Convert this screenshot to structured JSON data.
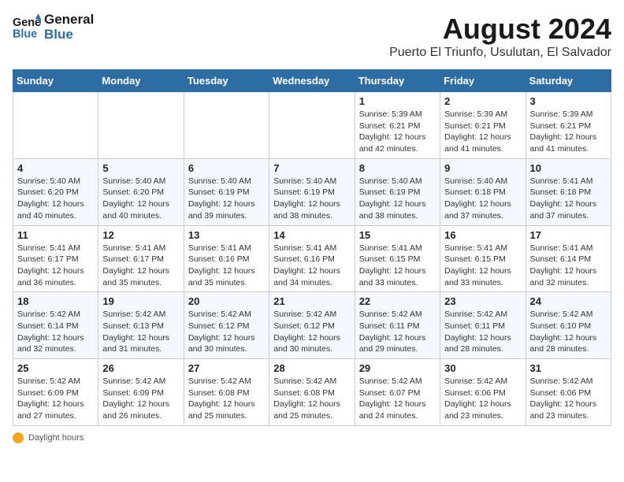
{
  "logo": {
    "line1": "General",
    "line2": "Blue"
  },
  "header": {
    "month": "August 2024",
    "location": "Puerto El Triunfo, Usulutan, El Salvador"
  },
  "days_of_week": [
    "Sunday",
    "Monday",
    "Tuesday",
    "Wednesday",
    "Thursday",
    "Friday",
    "Saturday"
  ],
  "weeks": [
    [
      {
        "day": "",
        "info": ""
      },
      {
        "day": "",
        "info": ""
      },
      {
        "day": "",
        "info": ""
      },
      {
        "day": "",
        "info": ""
      },
      {
        "day": "1",
        "info": "Sunrise: 5:39 AM\nSunset: 6:21 PM\nDaylight: 12 hours\nand 42 minutes."
      },
      {
        "day": "2",
        "info": "Sunrise: 5:39 AM\nSunset: 6:21 PM\nDaylight: 12 hours\nand 41 minutes."
      },
      {
        "day": "3",
        "info": "Sunrise: 5:39 AM\nSunset: 6:21 PM\nDaylight: 12 hours\nand 41 minutes."
      }
    ],
    [
      {
        "day": "4",
        "info": "Sunrise: 5:40 AM\nSunset: 6:20 PM\nDaylight: 12 hours\nand 40 minutes."
      },
      {
        "day": "5",
        "info": "Sunrise: 5:40 AM\nSunset: 6:20 PM\nDaylight: 12 hours\nand 40 minutes."
      },
      {
        "day": "6",
        "info": "Sunrise: 5:40 AM\nSunset: 6:19 PM\nDaylight: 12 hours\nand 39 minutes."
      },
      {
        "day": "7",
        "info": "Sunrise: 5:40 AM\nSunset: 6:19 PM\nDaylight: 12 hours\nand 38 minutes."
      },
      {
        "day": "8",
        "info": "Sunrise: 5:40 AM\nSunset: 6:19 PM\nDaylight: 12 hours\nand 38 minutes."
      },
      {
        "day": "9",
        "info": "Sunrise: 5:40 AM\nSunset: 6:18 PM\nDaylight: 12 hours\nand 37 minutes."
      },
      {
        "day": "10",
        "info": "Sunrise: 5:41 AM\nSunset: 6:18 PM\nDaylight: 12 hours\nand 37 minutes."
      }
    ],
    [
      {
        "day": "11",
        "info": "Sunrise: 5:41 AM\nSunset: 6:17 PM\nDaylight: 12 hours\nand 36 minutes."
      },
      {
        "day": "12",
        "info": "Sunrise: 5:41 AM\nSunset: 6:17 PM\nDaylight: 12 hours\nand 35 minutes."
      },
      {
        "day": "13",
        "info": "Sunrise: 5:41 AM\nSunset: 6:16 PM\nDaylight: 12 hours\nand 35 minutes."
      },
      {
        "day": "14",
        "info": "Sunrise: 5:41 AM\nSunset: 6:16 PM\nDaylight: 12 hours\nand 34 minutes."
      },
      {
        "day": "15",
        "info": "Sunrise: 5:41 AM\nSunset: 6:15 PM\nDaylight: 12 hours\nand 33 minutes."
      },
      {
        "day": "16",
        "info": "Sunrise: 5:41 AM\nSunset: 6:15 PM\nDaylight: 12 hours\nand 33 minutes."
      },
      {
        "day": "17",
        "info": "Sunrise: 5:41 AM\nSunset: 6:14 PM\nDaylight: 12 hours\nand 32 minutes."
      }
    ],
    [
      {
        "day": "18",
        "info": "Sunrise: 5:42 AM\nSunset: 6:14 PM\nDaylight: 12 hours\nand 32 minutes."
      },
      {
        "day": "19",
        "info": "Sunrise: 5:42 AM\nSunset: 6:13 PM\nDaylight: 12 hours\nand 31 minutes."
      },
      {
        "day": "20",
        "info": "Sunrise: 5:42 AM\nSunset: 6:12 PM\nDaylight: 12 hours\nand 30 minutes."
      },
      {
        "day": "21",
        "info": "Sunrise: 5:42 AM\nSunset: 6:12 PM\nDaylight: 12 hours\nand 30 minutes."
      },
      {
        "day": "22",
        "info": "Sunrise: 5:42 AM\nSunset: 6:11 PM\nDaylight: 12 hours\nand 29 minutes."
      },
      {
        "day": "23",
        "info": "Sunrise: 5:42 AM\nSunset: 6:11 PM\nDaylight: 12 hours\nand 28 minutes."
      },
      {
        "day": "24",
        "info": "Sunrise: 5:42 AM\nSunset: 6:10 PM\nDaylight: 12 hours\nand 28 minutes."
      }
    ],
    [
      {
        "day": "25",
        "info": "Sunrise: 5:42 AM\nSunset: 6:09 PM\nDaylight: 12 hours\nand 27 minutes."
      },
      {
        "day": "26",
        "info": "Sunrise: 5:42 AM\nSunset: 6:09 PM\nDaylight: 12 hours\nand 26 minutes."
      },
      {
        "day": "27",
        "info": "Sunrise: 5:42 AM\nSunset: 6:08 PM\nDaylight: 12 hours\nand 25 minutes."
      },
      {
        "day": "28",
        "info": "Sunrise: 5:42 AM\nSunset: 6:08 PM\nDaylight: 12 hours\nand 25 minutes."
      },
      {
        "day": "29",
        "info": "Sunrise: 5:42 AM\nSunset: 6:07 PM\nDaylight: 12 hours\nand 24 minutes."
      },
      {
        "day": "30",
        "info": "Sunrise: 5:42 AM\nSunset: 6:06 PM\nDaylight: 12 hours\nand 23 minutes."
      },
      {
        "day": "31",
        "info": "Sunrise: 5:42 AM\nSunset: 6:06 PM\nDaylight: 12 hours\nand 23 minutes."
      }
    ]
  ],
  "footer": {
    "daylight_label": "Daylight hours"
  }
}
